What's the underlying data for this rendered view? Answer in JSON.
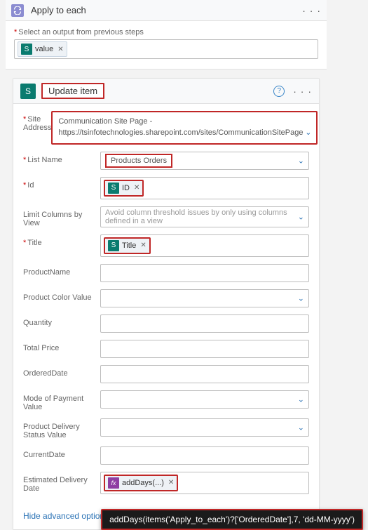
{
  "outer": {
    "title": "Apply to each",
    "more": "· · ·",
    "prev_label": "Select an output from previous steps",
    "token_value": "value"
  },
  "inner": {
    "title": "Update item",
    "more": "· · ·"
  },
  "fields": {
    "site_label": "Site Address",
    "site_value": "Communication Site Page - https://tsinfotechnologies.sharepoint.com/sites/CommunicationSitePage",
    "list_label": "List Name",
    "list_value": "Products Orders",
    "id_label": "Id",
    "id_token": "ID",
    "limit_label": "Limit Columns by View",
    "limit_hint": "Avoid column threshold issues by only using columns defined in a view",
    "title_label": "Title",
    "title_token": "Title",
    "prodname_label": "ProductName",
    "color_label": "Product Color Value",
    "qty_label": "Quantity",
    "price_label": "Total Price",
    "orddate_label": "OrderedDate",
    "payment_label": "Mode of Payment Value",
    "delivery_label": "Product Delivery Status Value",
    "currdate_label": "CurrentDate",
    "estdate_label": "Estimated Delivery Date",
    "estdate_token": "addDays(...)"
  },
  "advanced": "Hide advanced options",
  "tooltip": "addDays(items('Apply_to_each')?['OrderedDate'],7, 'dd-MM-yyyy')"
}
